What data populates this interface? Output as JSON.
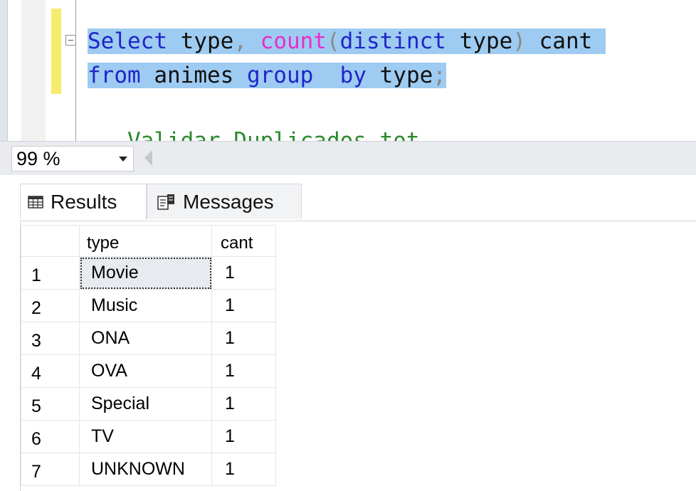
{
  "editor": {
    "line1": {
      "kw_select": "Select",
      "id_type": "type",
      "comma": ",",
      "fn_count": "count",
      "paren_open": "(",
      "kw_distinct": "distinct",
      "id_type2": "type",
      "paren_close": ")",
      "id_cant": "cant"
    },
    "line2": {
      "kw_from": "from",
      "id_table": "animes",
      "kw_group": "group",
      "kw_by": "by",
      "id_type": "type",
      "semicolon": ";"
    },
    "line3_partial": "-- Validar Duplicados tot"
  },
  "zoom": {
    "value": "99 %"
  },
  "tabs": [
    {
      "label": "Results",
      "icon": "grid-icon",
      "selected": true
    },
    {
      "label": "Messages",
      "icon": "messages-icon",
      "selected": false
    }
  ],
  "grid": {
    "columns": [
      "type",
      "cant"
    ],
    "rows": [
      {
        "num": "1",
        "type": "Movie",
        "cant": "1"
      },
      {
        "num": "2",
        "type": "Music",
        "cant": "1"
      },
      {
        "num": "3",
        "type": "ONA",
        "cant": "1"
      },
      {
        "num": "4",
        "type": "OVA",
        "cant": "1"
      },
      {
        "num": "5",
        "type": "Special",
        "cant": "1"
      },
      {
        "num": "6",
        "type": "TV",
        "cant": "1"
      },
      {
        "num": "7",
        "type": "UNKNOWN",
        "cant": "1"
      }
    ]
  },
  "colors": {
    "keyword": "#1f25c8",
    "function": "#e62fcd",
    "operator": "#8a8a8a",
    "selection": "#9ecbf1",
    "change_bar": "#f7ec6e"
  }
}
